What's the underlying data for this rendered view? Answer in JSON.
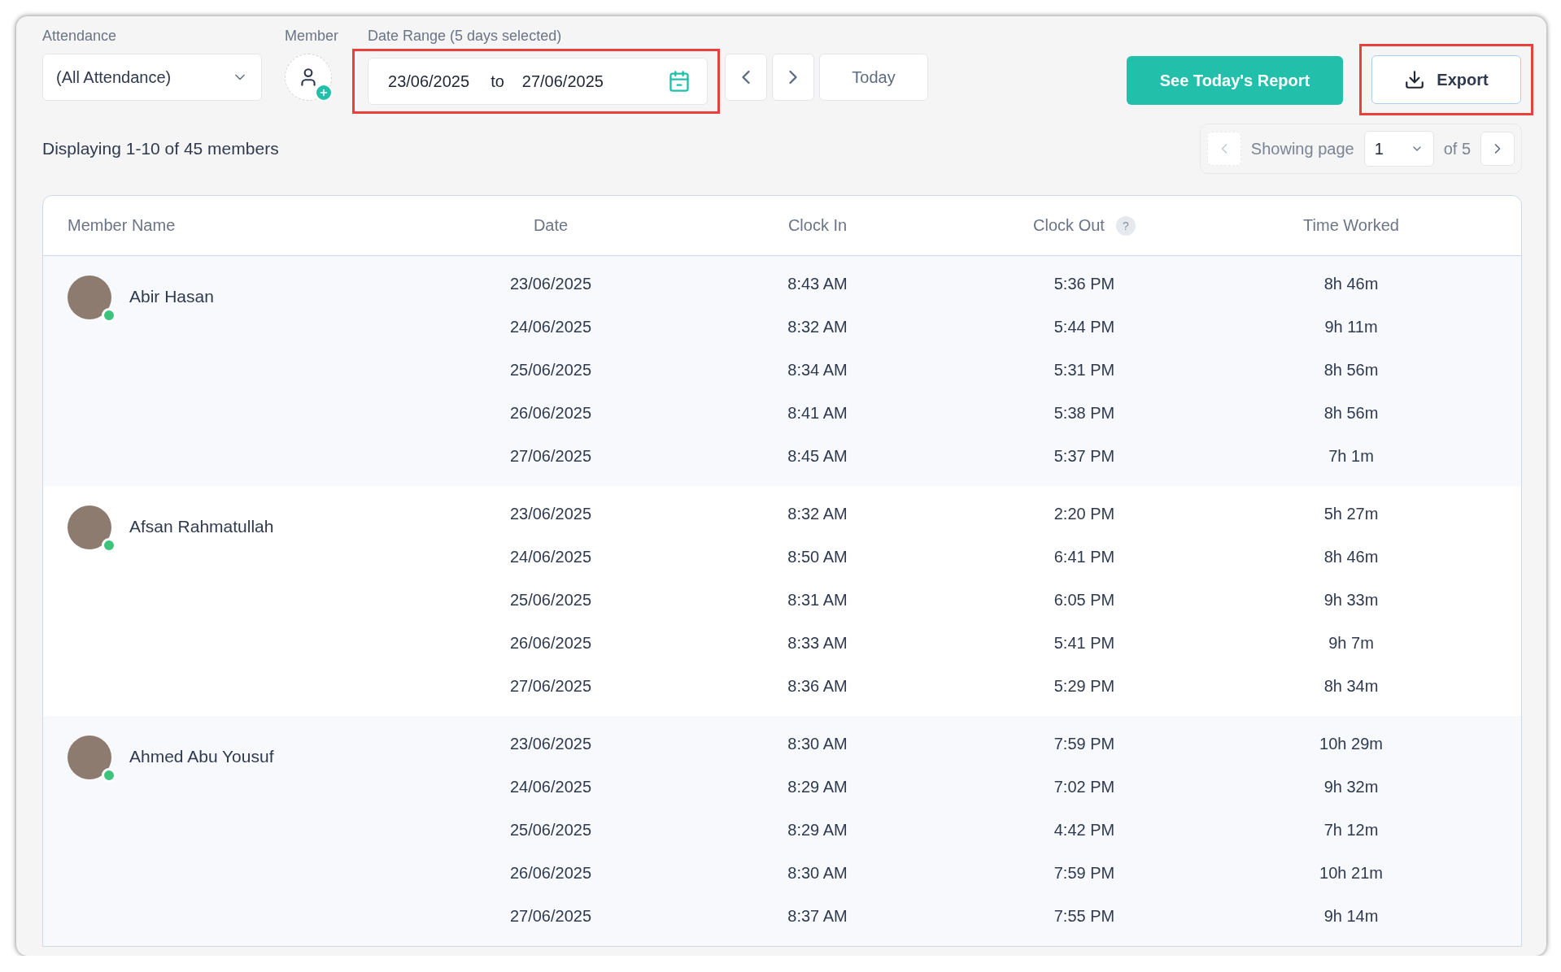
{
  "filters": {
    "attendance": {
      "label": "Attendance",
      "value": "(All Attendance)"
    },
    "member": {
      "label": "Member"
    },
    "date_range": {
      "label": "Date Range (5 days selected)",
      "from": "23/06/2025",
      "separator": "to",
      "to": "27/06/2025",
      "highlighted": true
    },
    "today_button": "Today"
  },
  "actions": {
    "report_button": "See Today's Report",
    "export": {
      "label": "Export",
      "highlighted": true
    }
  },
  "summary": "Displaying 1-10 of 45 members",
  "pagination": {
    "prefix": "Showing page",
    "page": "1",
    "suffix": "of 5",
    "prev_disabled": true,
    "next_disabled": false
  },
  "table": {
    "columns": [
      {
        "label": "Member Name"
      },
      {
        "label": "Date"
      },
      {
        "label": "Clock In"
      },
      {
        "label": "Clock Out",
        "help": "?"
      },
      {
        "label": "Time Worked"
      }
    ],
    "groups": [
      {
        "name": "Abir Hasan",
        "online": true,
        "rows": [
          [
            "23/06/2025",
            "8:43 AM",
            "5:36 PM",
            "8h 46m"
          ],
          [
            "24/06/2025",
            "8:32 AM",
            "5:44 PM",
            "9h 11m"
          ],
          [
            "25/06/2025",
            "8:34 AM",
            "5:31 PM",
            "8h 56m"
          ],
          [
            "26/06/2025",
            "8:41 AM",
            "5:38 PM",
            "8h 56m"
          ],
          [
            "27/06/2025",
            "8:45 AM",
            "5:37 PM",
            "7h 1m"
          ]
        ]
      },
      {
        "name": "Afsan Rahmatullah",
        "online": true,
        "rows": [
          [
            "23/06/2025",
            "8:32 AM",
            "2:20 PM",
            "5h 27m"
          ],
          [
            "24/06/2025",
            "8:50 AM",
            "6:41 PM",
            "8h 46m"
          ],
          [
            "25/06/2025",
            "8:31 AM",
            "6:05 PM",
            "9h 33m"
          ],
          [
            "26/06/2025",
            "8:33 AM",
            "5:41 PM",
            "9h 7m"
          ],
          [
            "27/06/2025",
            "8:36 AM",
            "5:29 PM",
            "8h 34m"
          ]
        ]
      },
      {
        "name": "Ahmed Abu Yousuf",
        "online": true,
        "rows": [
          [
            "23/06/2025",
            "8:30 AM",
            "7:59 PM",
            "10h 29m"
          ],
          [
            "24/06/2025",
            "8:29 AM",
            "7:02 PM",
            "9h 32m"
          ],
          [
            "25/06/2025",
            "8:29 AM",
            "4:42 PM",
            "7h 12m"
          ],
          [
            "26/06/2025",
            "8:30 AM",
            "7:59 PM",
            "10h 21m"
          ],
          [
            "27/06/2025",
            "8:37 AM",
            "7:55 PM",
            "9h 14m"
          ]
        ]
      }
    ]
  }
}
